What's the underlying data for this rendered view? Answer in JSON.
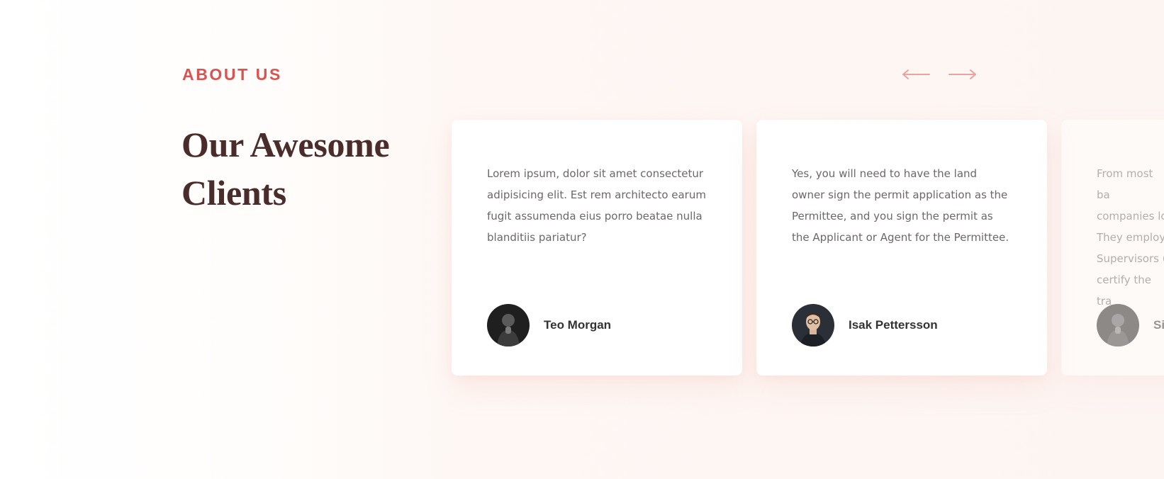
{
  "section": {
    "eyebrow": "ABOUT US",
    "heading": "Our Awesome Clients"
  },
  "nav": {
    "prev_icon": "arrow-left-icon",
    "next_icon": "arrow-right-icon"
  },
  "colors": {
    "accent": "#d9534f",
    "arrow": "#eba39f",
    "heading": "#4a2c2a",
    "text": "#6d6767",
    "name": "#333333"
  },
  "testimonials": [
    {
      "quote": "Lorem ipsum, dolor sit amet consectetur adipisicing elit. Est rem architecto earum fugit assumenda eius porro beatae nulla blanditiis pariatur?",
      "name": "Teo Morgan"
    },
    {
      "quote": "Yes, you will need to have the land owner sign the permit application as the Permittee, and you sign the permit as the Applicant or Agent for the Permittee.",
      "name": "Isak Pettersson"
    },
    {
      "quote": "From most ba companies lo They employ Supervisors ( certify the tra",
      "name": "Si"
    }
  ]
}
